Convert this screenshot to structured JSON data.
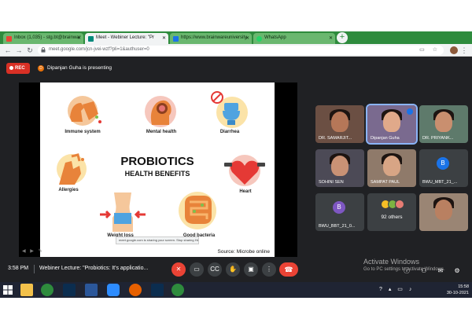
{
  "browser": {
    "tabs": [
      {
        "title": "Inbox (1,035) - stg.bt@brainwar",
        "favicon_color": "#ea4335",
        "active": false
      },
      {
        "title": "Meet - Webiner Lecture: \"Pr",
        "favicon_color": "#00897b",
        "active": true
      },
      {
        "title": "https://www.brainwareuniversity",
        "favicon_color": "#1a73e8",
        "active": false
      },
      {
        "title": "WhatsApp",
        "favicon_color": "#25d366",
        "active": false
      }
    ],
    "new_tab": "+",
    "url": "meet.google.com/jcn-jvei-wzf?pli=1&authuser=0"
  },
  "meet": {
    "rec_label": "REC",
    "presenter_initial": "D",
    "presenting_text": "Dipanjan Guha is presenting",
    "slide": {
      "title": "PROBIOTICS",
      "subtitle": "HEALTH BENEFITS",
      "labels": [
        "Immune system",
        "Mental health",
        "Diarrhea",
        "Allergies",
        "Heart",
        "Weight loss",
        "Good bacteria"
      ],
      "source": "Source: Microbe online",
      "share_tip": "meet.google.com is sharing your screen.   Stop sharing   Hide"
    },
    "participants": [
      {
        "name": "DR. SAMARJIT...",
        "type": "camera",
        "active": false
      },
      {
        "name": "Dipanjan Guha",
        "type": "camera",
        "active": true
      },
      {
        "name": "DR. PRIYANK...",
        "type": "camera",
        "active": false
      },
      {
        "name": "SOHINI SEN",
        "type": "camera",
        "active": false
      },
      {
        "name": "SAMPAT PAUL",
        "type": "camera",
        "active": false
      },
      {
        "name": "BWU_MBT_21_...",
        "type": "avatar",
        "initial": "B",
        "color": "#1a73e8",
        "active": false
      },
      {
        "name": "BWU_BBT_21_0...",
        "type": "avatar",
        "initial": "B",
        "color": "#7e57c2",
        "active": false
      },
      {
        "name": "92 others",
        "type": "others",
        "active": false
      },
      {
        "name": "",
        "type": "camera",
        "active": false
      }
    ],
    "bottom": {
      "time": "3:58 PM",
      "meeting_title": "Webiner Lecture: \"Probiotics: It's applicatio...",
      "watermark_title": "Activate Windows",
      "watermark_sub": "Go to PC settings to activate Windows."
    }
  },
  "taskbar": {
    "time": "15:58",
    "date": "30-10-2021"
  },
  "colors": {
    "tab_strip": "#2e8b3d",
    "meet_bg": "#202124",
    "end_call": "#ea4335"
  }
}
